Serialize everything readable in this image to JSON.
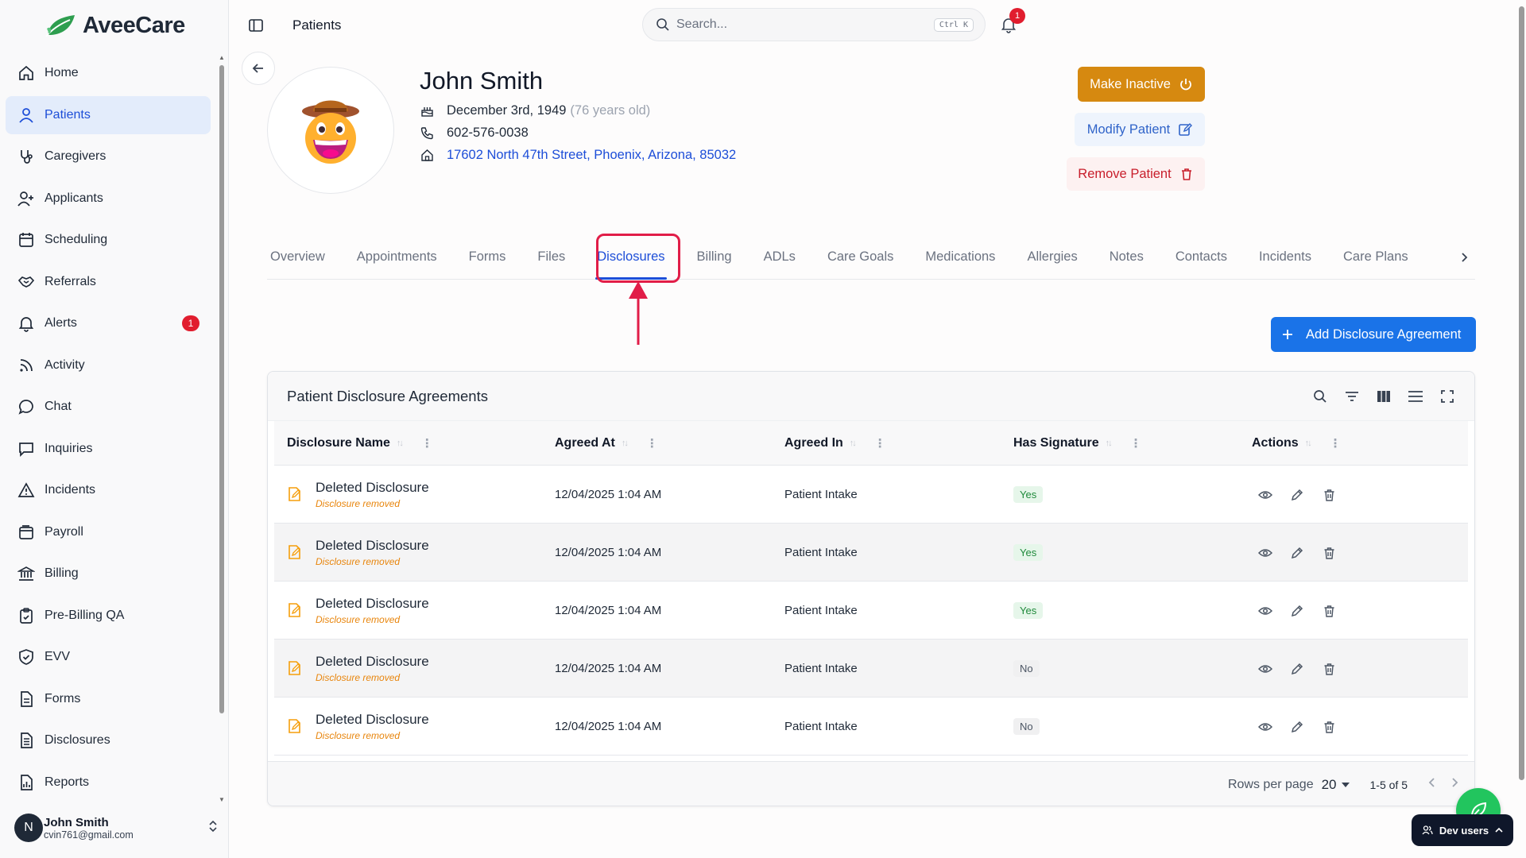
{
  "app": {
    "brand": "AveeCare"
  },
  "sidebar": {
    "items": [
      {
        "label": "Home",
        "icon": "home-icon"
      },
      {
        "label": "Patients",
        "icon": "user-icon",
        "active": true
      },
      {
        "label": "Caregivers",
        "icon": "stethoscope-icon"
      },
      {
        "label": "Applicants",
        "icon": "user-plus-icon"
      },
      {
        "label": "Scheduling",
        "icon": "calendar-icon"
      },
      {
        "label": "Referrals",
        "icon": "handshake-icon"
      },
      {
        "label": "Alerts",
        "icon": "bell-icon",
        "badge": "1"
      },
      {
        "label": "Activity",
        "icon": "rss-icon"
      },
      {
        "label": "Chat",
        "icon": "chat-bubble-icon"
      },
      {
        "label": "Inquiries",
        "icon": "message-square-icon"
      },
      {
        "label": "Incidents",
        "icon": "warning-triangle-icon"
      },
      {
        "label": "Payroll",
        "icon": "wallet-icon"
      },
      {
        "label": "Billing",
        "icon": "bank-icon"
      },
      {
        "label": "Pre-Billing QA",
        "icon": "clipboard-check-icon"
      },
      {
        "label": "EVV",
        "icon": "shield-check-icon"
      },
      {
        "label": "Forms",
        "icon": "file-text-icon"
      },
      {
        "label": "Disclosures",
        "icon": "file-list-icon"
      },
      {
        "label": "Reports",
        "icon": "report-chart-icon"
      }
    ]
  },
  "user": {
    "initial": "N",
    "name": "John Smith",
    "email": "cvin761@gmail.com"
  },
  "topbar": {
    "crumb": "Patients",
    "search_placeholder": "Search...",
    "search_shortcut": "Ctrl K",
    "notification_count": "1"
  },
  "patient": {
    "name": "John Smith",
    "dob": "December 3rd, 1949",
    "age": "(76 years old)",
    "phone": "602-576-0038",
    "address": "17602 North 47th Street, Phoenix, Arizona, 85032"
  },
  "actions": {
    "make_inactive": "Make Inactive",
    "modify": "Modify Patient",
    "remove": "Remove Patient"
  },
  "tabs": [
    "Overview",
    "Appointments",
    "Forms",
    "Files",
    "Disclosures",
    "Billing",
    "ADLs",
    "Care Goals",
    "Medications",
    "Allergies",
    "Notes",
    "Contacts",
    "Incidents",
    "Care Plans"
  ],
  "active_tab": "Disclosures",
  "add_button": "Add Disclosure Agreement",
  "table": {
    "title": "Patient Disclosure Agreements",
    "columns": [
      "Disclosure Name",
      "Agreed At",
      "Agreed In",
      "Has Signature",
      "Actions"
    ],
    "rows": [
      {
        "name": "Deleted Disclosure",
        "note": "Disclosure removed",
        "agreed_at": "12/04/2025 1:04 AM",
        "agreed_in": "Patient Intake",
        "signature": "Yes"
      },
      {
        "name": "Deleted Disclosure",
        "note": "Disclosure removed",
        "agreed_at": "12/04/2025 1:04 AM",
        "agreed_in": "Patient Intake",
        "signature": "Yes"
      },
      {
        "name": "Deleted Disclosure",
        "note": "Disclosure removed",
        "agreed_at": "12/04/2025 1:04 AM",
        "agreed_in": "Patient Intake",
        "signature": "Yes"
      },
      {
        "name": "Deleted Disclosure",
        "note": "Disclosure removed",
        "agreed_at": "12/04/2025 1:04 AM",
        "agreed_in": "Patient Intake",
        "signature": "No"
      },
      {
        "name": "Deleted Disclosure",
        "note": "Disclosure removed",
        "agreed_at": "12/04/2025 1:04 AM",
        "agreed_in": "Patient Intake",
        "signature": "No"
      }
    ],
    "rows_per_page_label": "Rows per page",
    "rows_per_page": "20",
    "range": "1-5 of 5"
  },
  "dev_users": "Dev users",
  "colors": {
    "accent": "#1a73e8",
    "inactive": "#d68910",
    "danger": "#c81e2b",
    "annotation": "#e11d48"
  }
}
